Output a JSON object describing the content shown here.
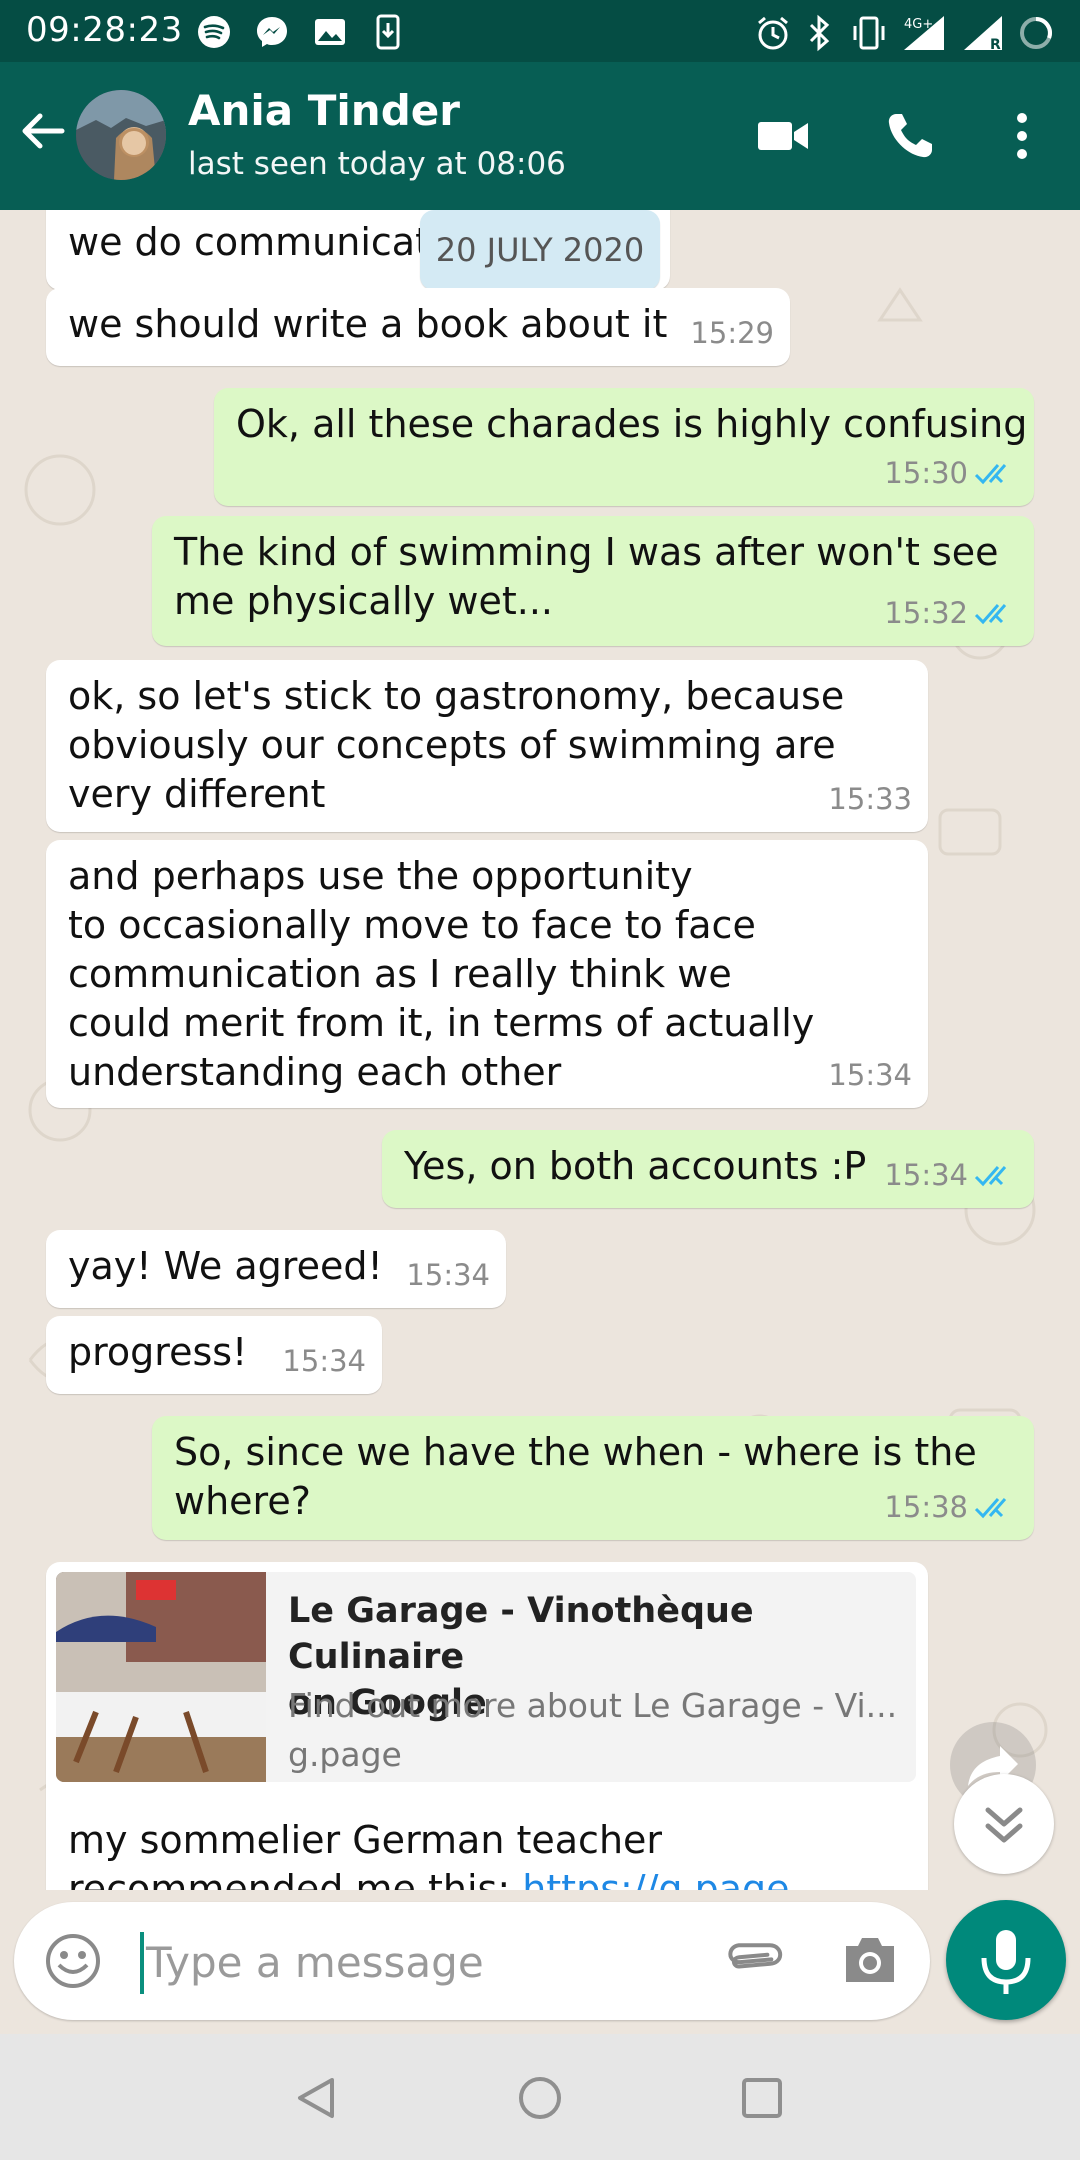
{
  "status_bar": {
    "time": "09:28:23"
  },
  "header": {
    "contact_name": "Ania Tinder",
    "last_seen": "last seen today at 08:06"
  },
  "date_chip": "20 JULY 2020",
  "messages": [
    {
      "dir": "in",
      "text": "we do communicat",
      "time": ""
    },
    {
      "dir": "in",
      "text": "we should write a book about it",
      "time": "15:29"
    },
    {
      "dir": "out",
      "text": "Ok, all these charades is highly confusing",
      "time": "15:30"
    },
    {
      "dir": "out",
      "text": "The kind of swimming I was after won't see\nme physically wet...",
      "time": "15:32"
    },
    {
      "dir": "in",
      "text": "ok, so let's stick to gastronomy, because\nobviously our concepts of swimming are\nvery different",
      "time": "15:33"
    },
    {
      "dir": "in",
      "text": "and perhaps use the opportunity\nto occasionally move to face to face\ncommunication as I really think we\ncould merit from it, in terms of actually\nunderstanding each other",
      "time": "15:34"
    },
    {
      "dir": "out",
      "text": "Yes, on both accounts :P",
      "time": "15:34"
    },
    {
      "dir": "in",
      "text": "yay! We agreed!",
      "time": "15:34"
    },
    {
      "dir": "in",
      "text": "progress!",
      "time": "15:34"
    },
    {
      "dir": "out",
      "text": "So, since we have the when - where is the\nwhere?",
      "time": "15:38"
    }
  ],
  "link_message": {
    "preview_title": "Le Garage - Vinothèque Culinaire\non Google",
    "preview_desc": "Find out more about Le Garage - Vi...",
    "preview_domain": "g.page",
    "text_before_link": "my sommelier German teacher\nrecommended me this: ",
    "link_text": "https://g.page"
  },
  "composer": {
    "placeholder": "Type a message"
  },
  "colors": {
    "header": "#075e54",
    "status_bar": "#054d44",
    "outgoing_bubble": "#dcf8c6",
    "incoming_bubble": "#ffffff",
    "read_ticks": "#34b7f1",
    "mic_button": "#00897b"
  }
}
